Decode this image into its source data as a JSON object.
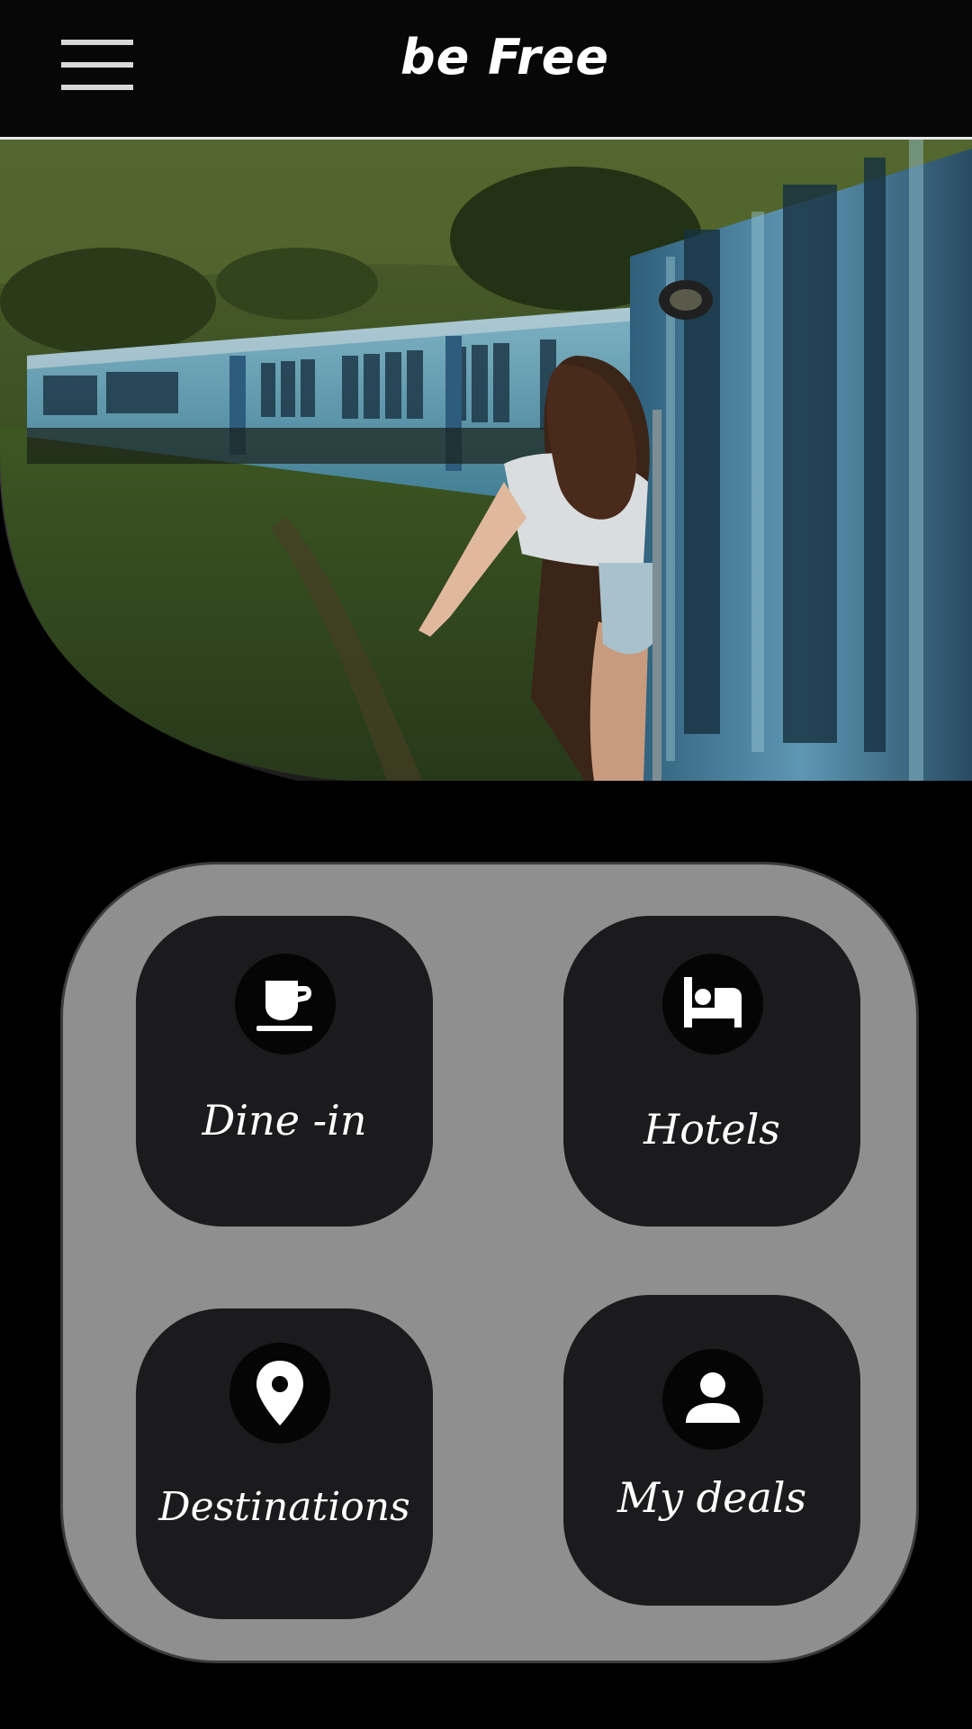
{
  "header": {
    "title": "be Free",
    "menu_icon": "hamburger-menu-icon"
  },
  "hero": {
    "description_icon": "hero-photo"
  },
  "colors": {
    "background": "#000000",
    "panel": "#8f8f8f",
    "tile": "#1b1b1d",
    "text": "#ffffff"
  },
  "categories": [
    {
      "label": "Dine -in",
      "icon": "coffee-cup-icon"
    },
    {
      "label": "Hotels",
      "icon": "bed-icon"
    },
    {
      "label": "Destinations",
      "icon": "location-pin-icon"
    },
    {
      "label": "My deals",
      "icon": "person-icon"
    }
  ]
}
